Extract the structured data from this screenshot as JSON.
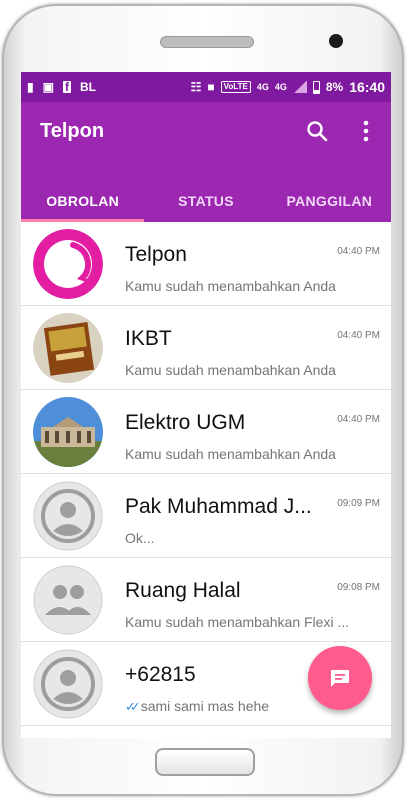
{
  "status_bar": {
    "carrier_icons": [
      "alert-icon",
      "image-icon",
      "facebook-icon"
    ],
    "bbm_label": "BL",
    "volte_label": "VoLTE",
    "network_label_1": "4G",
    "network_label_2": "4G",
    "battery_percent": "8%",
    "time": "16:40"
  },
  "app_bar": {
    "title": "Telpon"
  },
  "tabs": [
    {
      "label": "OBROLAN",
      "active": true
    },
    {
      "label": "STATUS",
      "active": false
    },
    {
      "label": "PANGGILAN",
      "active": false
    }
  ],
  "chats": [
    {
      "name": "Telpon",
      "time": "04:40 PM",
      "message": "Kamu sudah menambahkan Anda",
      "avatar": "telpon-logo"
    },
    {
      "name": "IKBT",
      "time": "04:40 PM",
      "message": "Kamu sudah menambahkan Anda",
      "avatar": "book-cover"
    },
    {
      "name": "Elektro UGM",
      "time": "04:40 PM",
      "message": "Kamu sudah menambahkan Anda",
      "avatar": "building-photo"
    },
    {
      "name": "Pak Muhammad J...",
      "time": "09:09 PM",
      "message": "Ok...",
      "avatar": "default-person"
    },
    {
      "name": "Ruang Halal",
      "time": "09:08 PM",
      "message": "Kamu sudah menambahkan Flexi ...",
      "avatar": "default-group"
    },
    {
      "name": "+62815",
      "time": "",
      "message": "sami sami mas hehe",
      "avatar": "default-person",
      "read_receipt": "double-check-icon"
    }
  ],
  "colors": {
    "status_bar": "#7f1aa0",
    "app_bar": "#9c27b0",
    "tab_indicator": "#ff80ab",
    "fab": "#ff5c8d",
    "read_tick": "#3a8ce0"
  },
  "fab_icon": "new-chat-icon"
}
